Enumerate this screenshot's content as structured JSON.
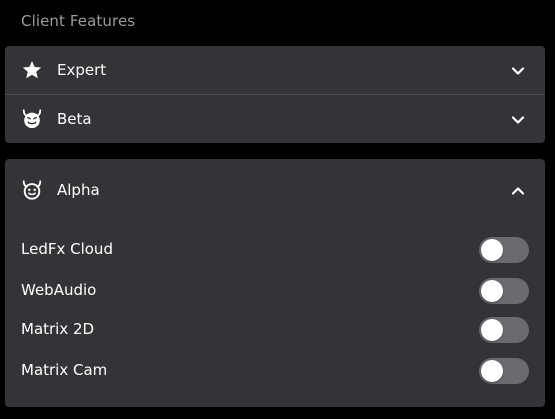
{
  "section": {
    "title": "Client Features"
  },
  "accordions": {
    "expert": {
      "label": "Expert",
      "icon": "star-icon",
      "expanded": false
    },
    "beta": {
      "label": "Beta",
      "icon": "devil-face-icon",
      "expanded": false
    },
    "alpha": {
      "label": "Alpha",
      "icon": "devil-face-icon",
      "expanded": true
    }
  },
  "alpha_features": [
    {
      "label": "LedFx Cloud",
      "enabled": false
    },
    {
      "label": "WebAudio",
      "enabled": false
    },
    {
      "label": "Matrix 2D",
      "enabled": false
    },
    {
      "label": "Matrix Cam",
      "enabled": false
    }
  ],
  "colors": {
    "background": "#000000",
    "panel": "#343338",
    "switch_off_track": "#6b6a70",
    "muted_text": "#9b9ba0"
  }
}
